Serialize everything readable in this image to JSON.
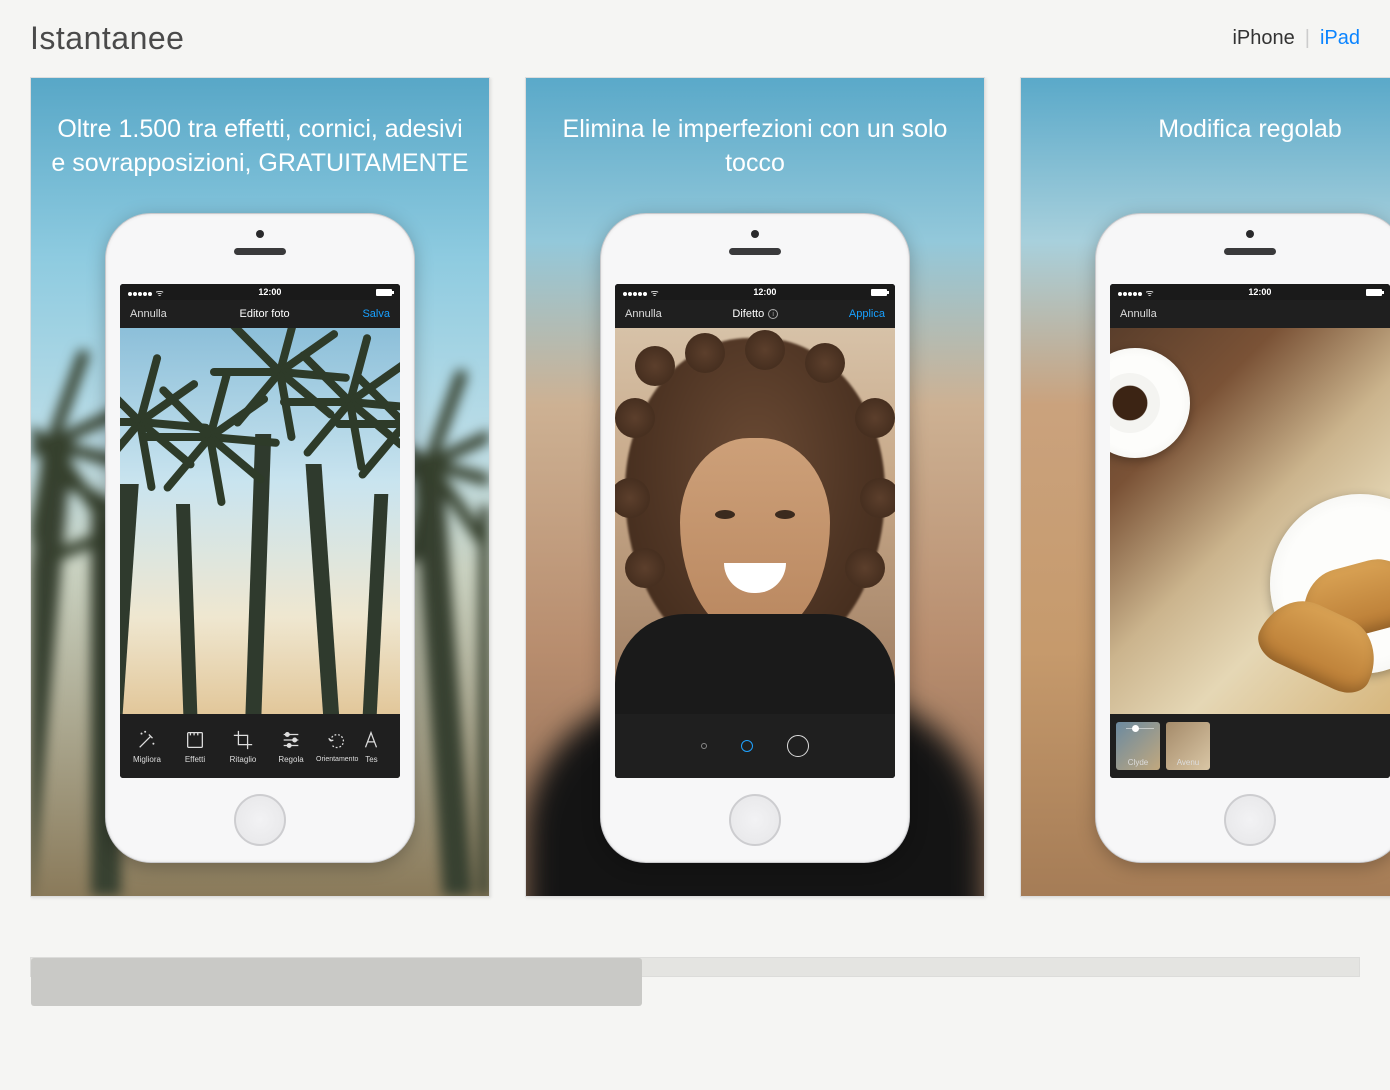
{
  "header": {
    "section_title": "Istantanee",
    "device_iphone": "iPhone",
    "device_ipad": "iPad"
  },
  "shots": [
    {
      "caption": "Oltre 1.500 tra effetti, cornici, adesivi e sovrapposizioni, GRATUITAMENTE",
      "status_time": "12:00",
      "nav_left": "Annulla",
      "nav_center": "Editor foto",
      "nav_right": "Salva",
      "tools": [
        {
          "name": "enhance",
          "label": "Migliora"
        },
        {
          "name": "effects",
          "label": "Effetti"
        },
        {
          "name": "crop",
          "label": "Ritaglio"
        },
        {
          "name": "adjust",
          "label": "Regola"
        },
        {
          "name": "orientation",
          "label": "Orientamento"
        },
        {
          "name": "text",
          "label": "Tes"
        }
      ]
    },
    {
      "caption": "Elimina le imperfezioni con un solo tocco",
      "status_time": "12:00",
      "nav_left": "Annulla",
      "nav_center": "Difetto",
      "nav_right": "Applica"
    },
    {
      "caption": "Modifica regolab",
      "status_time": "12:00",
      "nav_left": "Annulla",
      "thumbs": [
        {
          "label": "Clyde"
        },
        {
          "label": "Avenu"
        }
      ]
    }
  ]
}
